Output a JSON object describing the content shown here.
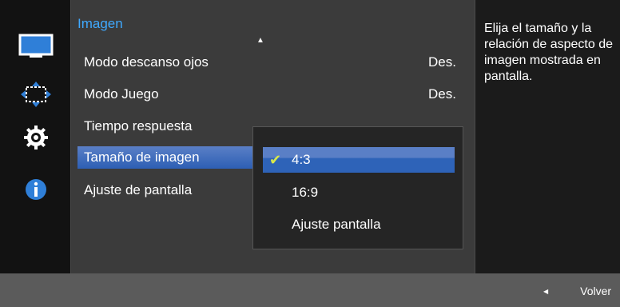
{
  "menu": {
    "title": "Imagen",
    "items": [
      {
        "label": "Modo descanso ojos",
        "value": "Des."
      },
      {
        "label": "Modo Juego",
        "value": "Des."
      },
      {
        "label": "Tiempo respuesta",
        "value": ""
      },
      {
        "label": "Tamaño de imagen",
        "value": ""
      },
      {
        "label": "Ajuste de pantalla",
        "value": ""
      }
    ]
  },
  "popup": {
    "options": [
      {
        "label": "4:3"
      },
      {
        "label": "16:9"
      },
      {
        "label": "Ajuste pantalla"
      }
    ],
    "selected_index": 0
  },
  "help": {
    "text": "Elija el tamaño y la relación de aspecto de imagen mostrada en pantalla."
  },
  "bottom": {
    "back_label": "Volver"
  },
  "colors": {
    "accent": "#3fa9ff",
    "selected": "#2d5fb4",
    "check": "#d8e84a"
  }
}
